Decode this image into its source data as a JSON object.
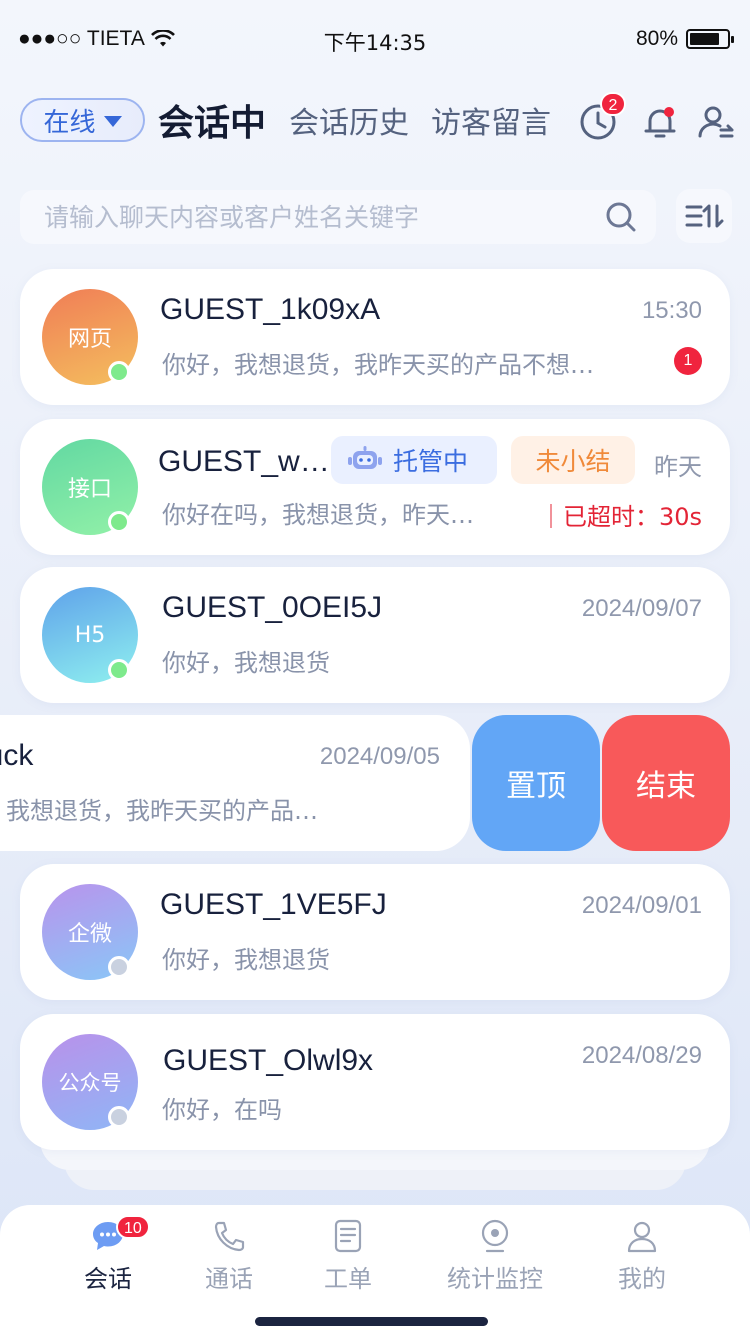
{
  "status_bar": {
    "carrier": "●●●○○ TIETA",
    "time": "下午14:35",
    "battery": "80%",
    "battery_level": 0.8
  },
  "header": {
    "status": "在线",
    "tabs": [
      {
        "label": "会话中",
        "active": true
      },
      {
        "label": "会话历史",
        "active": false
      },
      {
        "label": "访客留言",
        "active": false
      }
    ],
    "queue_badge": "2"
  },
  "search": {
    "placeholder": "请输入聊天内容或客户姓名关键字"
  },
  "sessions": [
    {
      "avatar_label": "网页",
      "name": "GUEST_1k09xA",
      "time": "15:30",
      "preview": "你好，我想退货，我昨天买的产品不想…",
      "unread": "1"
    },
    {
      "avatar_label": "接口",
      "name": "GUEST_w…",
      "time": "昨天",
      "preview": "你好在吗，我想退货，昨天…",
      "tag_ai": "托管中",
      "tag_pending": "未小结",
      "timeout": "｜已超时：30s"
    },
    {
      "avatar_label": "H5",
      "name": "GUEST_0OEI5J",
      "time": "2024/09/07",
      "preview": "你好，我想退货"
    },
    {
      "name": "luck",
      "time": "2024/09/05",
      "preview": "，我想退货，我昨天买的产品…",
      "action_pin": "置顶",
      "action_end": "结束"
    },
    {
      "avatar_label": "企微",
      "name": "GUEST_1VE5FJ",
      "time": "2024/09/01",
      "preview": "你好，我想退货"
    },
    {
      "avatar_label": "公众号",
      "name": "GUEST_Olwl9x",
      "time": "2024/08/29",
      "preview": "你好，在吗"
    }
  ],
  "tabbar": {
    "items": [
      {
        "label": "会话",
        "badge": "10"
      },
      {
        "label": "通话"
      },
      {
        "label": "工单"
      },
      {
        "label": "统计监控"
      },
      {
        "label": "我的"
      }
    ]
  },
  "colors": {
    "accent": "#3567d8",
    "danger": "#f0243e",
    "pin": "#62a6f6",
    "end": "#f8595a",
    "pending": "#f08a3a"
  }
}
